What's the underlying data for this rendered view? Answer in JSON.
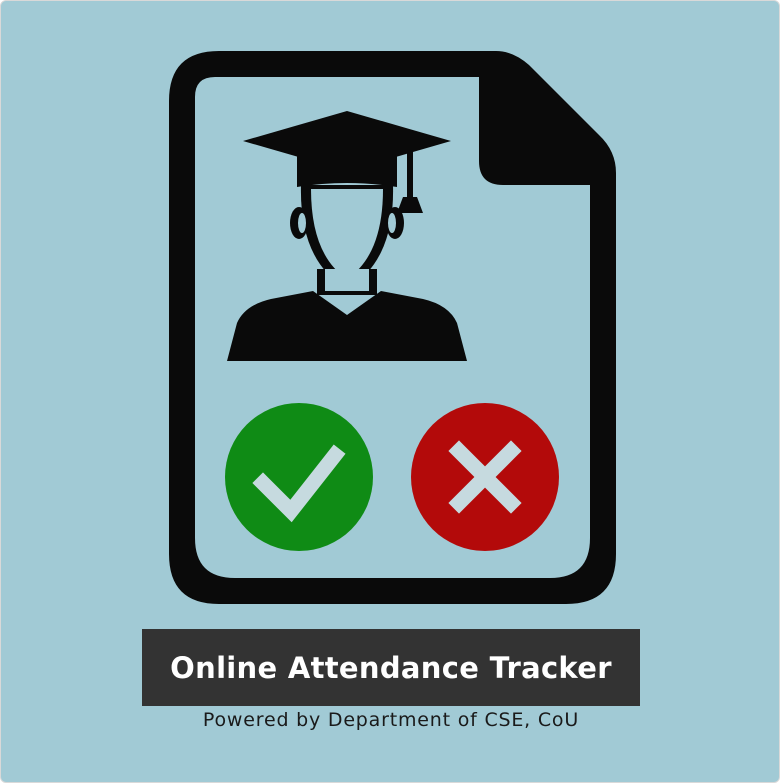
{
  "app": {
    "title": "Online Attendance Tracker",
    "subtitle": "Powered by Department of CSE, CoU"
  },
  "icons": {
    "document": "document-icon",
    "graduate": "graduate-icon",
    "present": "checkmark-icon",
    "absent": "cross-icon"
  },
  "colors": {
    "background": "#a1cad5",
    "ink": "#0a0a0a",
    "present": "#0f8b15",
    "absent": "#b30a0a",
    "title_bar": "#333333",
    "title_text": "#ffffff",
    "subtitle_text": "#1a1a1a"
  }
}
